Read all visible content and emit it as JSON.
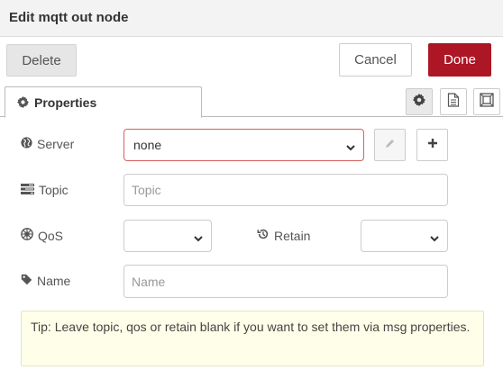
{
  "dialog": {
    "title": "Edit mqtt out node"
  },
  "toolbar": {
    "delete_label": "Delete",
    "cancel_label": "Cancel",
    "done_label": "Done"
  },
  "tabs": {
    "active_label": "Properties",
    "icon_tabs": [
      "gear-icon",
      "description-icon",
      "appearance-icon"
    ]
  },
  "form": {
    "server": {
      "label": "Server",
      "value": "none"
    },
    "topic": {
      "label": "Topic",
      "value": "",
      "placeholder": "Topic"
    },
    "qos": {
      "label": "QoS",
      "value": ""
    },
    "retain": {
      "label": "Retain",
      "value": ""
    },
    "name": {
      "label": "Name",
      "value": "",
      "placeholder": "Name"
    }
  },
  "tip": {
    "text": "Tip: Leave topic, qos or retain blank if you want to set them via msg properties."
  },
  "colors": {
    "primary": "#ad1625",
    "error_border": "#d6615f",
    "tip_bg": "#ffffe9"
  }
}
